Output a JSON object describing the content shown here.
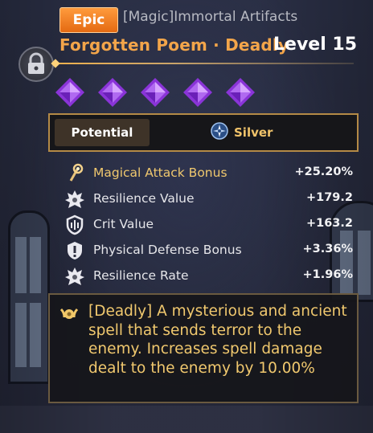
{
  "header": {
    "rarity": "Epic",
    "category": "[Magic]Immortal Artifacts",
    "item_name": "Forgotten Poem · Deadly",
    "level": "Level 15"
  },
  "icons": {
    "lock": "lock-icon",
    "gem": "purple-gem-icon",
    "silver": "silver-compass-icon"
  },
  "gems_count": 5,
  "tabs": {
    "potential": "Potential",
    "silver": "Silver"
  },
  "stats": [
    {
      "label": "Magical Attack Bonus",
      "value": "+25.20%",
      "highlight": true
    },
    {
      "label": "Resilience Value",
      "value": "+179.2"
    },
    {
      "label": "Crit Value",
      "value": "+163.2"
    },
    {
      "label": "Physical Defense Bonus",
      "value": "+3.36%"
    },
    {
      "label": "Resilience Rate",
      "value": "+1.96%"
    }
  ],
  "description": "[Deadly] A mysterious and ancient spell that sends terror to the enemy. Increases spell damage dealt to the enemy by 10.00%",
  "colors": {
    "epic": "#f0882a",
    "name": "#f3a54a",
    "gold_text": "#f0c86e",
    "gem": "#a24de8"
  }
}
